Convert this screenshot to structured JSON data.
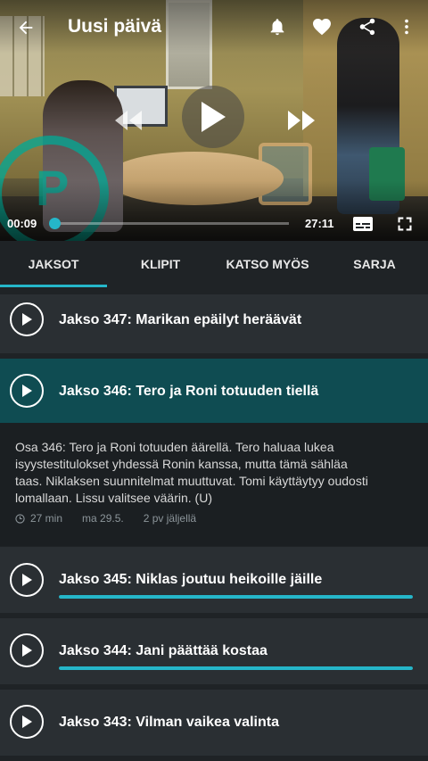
{
  "player": {
    "title": "Uusi päivä",
    "current_time": "00:09",
    "duration": "27:11",
    "progress_fraction": 0.005,
    "watermark_letter": "P",
    "icons": {
      "back": "arrow-left-icon",
      "notify": "bell-icon",
      "favorite": "heart-icon",
      "share": "share-icon",
      "more": "more-vertical-icon",
      "rewind": "rewind-icon",
      "play": "play-icon",
      "forward": "fast-forward-icon",
      "subtitles": "subtitles-icon",
      "fullscreen": "fullscreen-icon"
    }
  },
  "tabs": [
    {
      "label": "JAKSOT",
      "active": true
    },
    {
      "label": "KLIPIT",
      "active": false
    },
    {
      "label": "KATSO MYÖS",
      "active": false
    },
    {
      "label": "SARJA",
      "active": false
    }
  ],
  "episodes": [
    {
      "title": "Jakso 347: Marikan epäilyt heräävät",
      "progress": null
    },
    {
      "title": "Jakso 346: Tero ja Roni totuuden tiellä",
      "progress": null,
      "selected": true
    },
    {
      "title": "Jakso 345: Niklas joutuu heikoille jäille",
      "progress": 1.0
    },
    {
      "title": "Jakso 344: Jani päättää kostaa",
      "progress": 1.0
    },
    {
      "title": "Jakso 343: Vilman vaikea valinta",
      "progress": null
    }
  ],
  "selected_detail": {
    "description": "Osa 346: Tero ja Roni totuuden äärellä. Tero haluaa lukea isyystestitulokset yhdessä Ronin kanssa, mutta tämä sähläa taas. Niklaksen suunnitelmat muuttuvat. Tomi käyttäytyy oudosti lomallaan. Lissu valitsee väärin. (U)",
    "duration": "27 min",
    "date": "ma 29.5.",
    "remaining": "2 pv jäljellä"
  },
  "colors": {
    "accent": "#25b6c9",
    "selected_row": "#0f4c52",
    "row": "#2a2f33",
    "background": "#1f2326"
  }
}
